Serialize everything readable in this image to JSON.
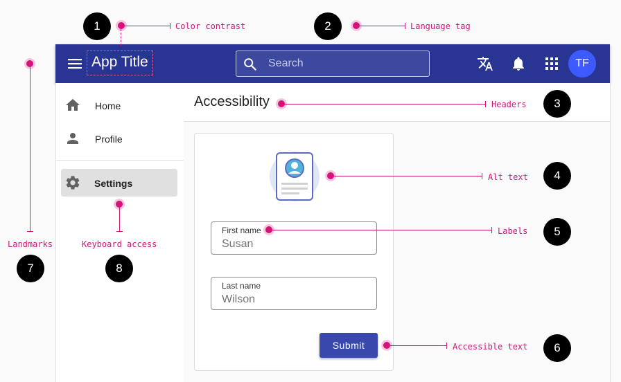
{
  "app": {
    "title": "App Title",
    "avatar_initials": "TF"
  },
  "search": {
    "placeholder": "Search"
  },
  "sidebar": {
    "items": [
      {
        "label": "Home",
        "icon": "home-icon"
      },
      {
        "label": "Profile",
        "icon": "person-icon"
      },
      {
        "label": "Settings",
        "icon": "gear-icon",
        "selected": true
      }
    ]
  },
  "page": {
    "heading": "Accessibility"
  },
  "form": {
    "first_name": {
      "label": "First name",
      "value": "Susan"
    },
    "last_name": {
      "label": "Last name",
      "value": "Wilson"
    },
    "submit_label": "Submit"
  },
  "annotations": [
    {
      "number": "1",
      "text": "Color contrast"
    },
    {
      "number": "2",
      "text": "Language tag"
    },
    {
      "number": "3",
      "text": "Headers"
    },
    {
      "number": "4",
      "text": "Alt text"
    },
    {
      "number": "5",
      "text": "Labels"
    },
    {
      "number": "6",
      "text": "Accessible text"
    },
    {
      "number": "7",
      "text": "Landmarks"
    },
    {
      "number": "8",
      "text": "Keyboard access"
    }
  ],
  "colors": {
    "appbar": "#283593",
    "accent": "#3949ab",
    "avatar": "#3d5afe",
    "annotation": "#d4147a"
  }
}
